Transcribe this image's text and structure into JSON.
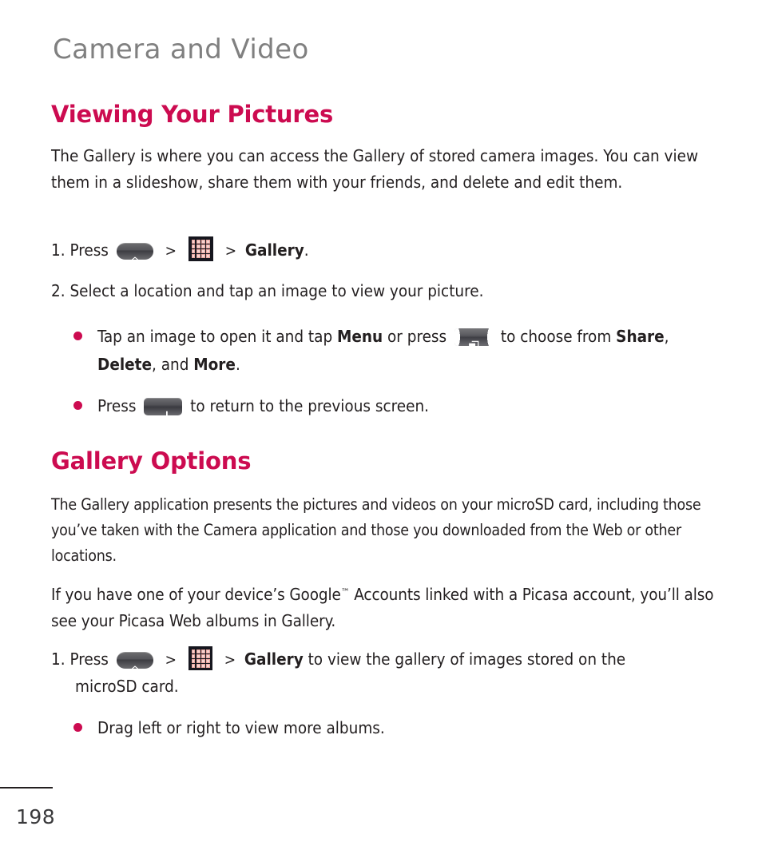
{
  "document": {
    "chapter_title": "Camera and Video",
    "page_number": "198",
    "accent_color": "#cc0b50",
    "title_color": "#808080",
    "text_color": "#231f20"
  },
  "sections": {
    "viewing": {
      "heading": "Viewing Your Pictures",
      "intro": "The Gallery is where you can access the Gallery of stored camera images. You can view them in a slideshow, share them with your friends, and delete and edit them.",
      "step1": {
        "number": "1.",
        "press_label": "Press",
        "home_key_icon": "home-key-icon",
        "separator": ">",
        "apps_icon": "apps-grid-icon",
        "target": "Gallery",
        "period": "."
      },
      "step2": {
        "number": "2.",
        "text": "Select a location and tap an image to view your picture."
      },
      "bullet1": {
        "part1": "Tap an image to open it and tap ",
        "bold1": "Menu",
        "part2": " or press ",
        "menu_key_icon": "menu-key-icon",
        "part3": " to choose from ",
        "bold2": "Share",
        "part4": ", ",
        "bold3": "Delete",
        "part5": ", and ",
        "bold4": "More",
        "part6": "."
      },
      "bullet2": {
        "part1": "Press ",
        "back_key_icon": "back-key-icon",
        "part2": " to return to the previous screen."
      }
    },
    "gallery_options": {
      "heading": "Gallery Options",
      "paragraph1": "The Gallery application presents the pictures and videos on your microSD card, including those you’ve taken with the Camera application and those you downloaded from the Web or other locations.",
      "paragraph2_part1": "If you have one of your device’s Google",
      "paragraph2_tm": "™",
      "paragraph2_part2": " Accounts linked with a Picasa account, you’ll also see your Picasa Web albums in Gallery.",
      "step1": {
        "number": "1.",
        "press_label": "Press",
        "home_key_icon": "home-key-icon",
        "separator": ">",
        "apps_icon": "apps-grid-icon",
        "target": "Gallery",
        "trailing": " to view the gallery of images stored on the",
        "continuation": "microSD card."
      },
      "bullet1": {
        "text": "Drag left or right to view more albums."
      }
    }
  }
}
